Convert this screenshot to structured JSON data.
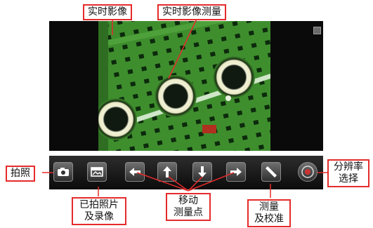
{
  "callouts": {
    "live_view": "实时影像",
    "live_measure": "实时影像测量",
    "capture": "拍照",
    "gallery_line1": "已拍照片",
    "gallery_line2": "及录像",
    "move_line1": "移动",
    "move_line2": "测量点",
    "measure_line1": "测量",
    "measure_line2": "及校准",
    "resolution_line1": "分辨率",
    "resolution_line2": "选择"
  },
  "toolbar": {
    "buttons": [
      "camera-icon",
      "gallery-icon",
      "arrow-left-icon",
      "arrow-up-icon",
      "arrow-down-icon",
      "arrow-right-icon",
      "ruler-icon",
      "resolution-icon"
    ]
  },
  "colors": {
    "callout_border": "#e52b2b",
    "pcb_green": "#3c8a2c",
    "toolbar_bg": "#141414"
  }
}
